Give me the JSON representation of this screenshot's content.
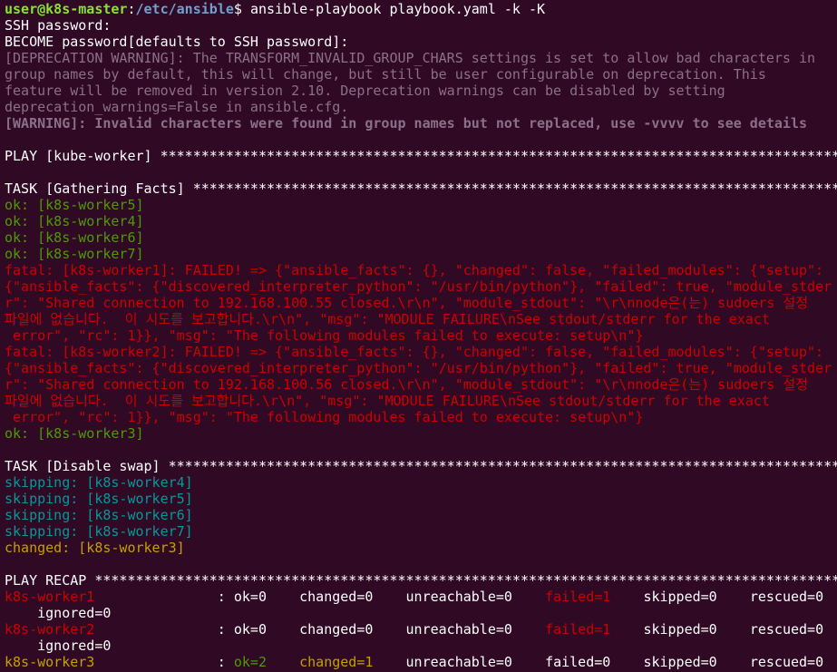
{
  "colors": {
    "background": "#300a24",
    "prompt_user": "#8ae234",
    "prompt_path": "#729fcf",
    "text": "#ffffff",
    "dim": "#8c6f8a",
    "ok": "#4e9a06",
    "fatal": "#cc0000",
    "skipping": "#06989a",
    "changed": "#c4a000"
  },
  "prompt": {
    "user_host": "user@k8s-master",
    "colon": ":",
    "path": "/etc/ansible",
    "dollar": "$ ",
    "command": "ansible-playbook playbook.yaml -k -K"
  },
  "lines": {
    "ssh_password": "SSH password:",
    "become_password": "BECOME password[defaults to SSH password]:",
    "deprecation_1": "[DEPRECATION WARNING]: The TRANSFORM_INVALID_GROUP_CHARS settings is set to allow bad characters in",
    "deprecation_2": "group names by default, this will change, but still be user configurable on deprecation. This",
    "deprecation_3": "feature will be removed in version 2.10. Deprecation warnings can be disabled by setting",
    "deprecation_4": "deprecation_warnings=False in ansible.cfg.",
    "warning": "[WARNING]: Invalid characters were found in group names but not replaced, use -vvvv to see details",
    "play_header": "PLAY [kube-worker] ************************************************************************************",
    "task_facts": "TASK [Gathering Facts] ********************************************************************************",
    "ok_worker5": "ok: [k8s-worker5]",
    "ok_worker4": "ok: [k8s-worker4]",
    "ok_worker6": "ok: [k8s-worker6]",
    "ok_worker7": "ok: [k8s-worker7]",
    "fatal1_1": "fatal: [k8s-worker1]: FAILED! => {\"ansible_facts\": {}, \"changed\": false, \"failed_modules\": {\"setup\":",
    "fatal1_2": "{\"ansible_facts\": {\"discovered_interpreter_python\": \"/usr/bin/python\"}, \"failed\": true, \"module_stder",
    "fatal1_3": "r\": \"Shared connection to 192.168.100.55 closed.\\r\\n\", \"module_stdout\": \"\\r\\nnode은(는) sudoers 설정",
    "fatal1_4": "파일에 없습니다.  이 시도를 보고합니다.\\r\\n\", \"msg\": \"MODULE FAILURE\\nSee stdout/stderr for the exact",
    "fatal1_5": " error\", \"rc\": 1}}, \"msg\": \"The following modules failed to execute: setup\\n\"}",
    "fatal2_1": "fatal: [k8s-worker2]: FAILED! => {\"ansible_facts\": {}, \"changed\": false, \"failed_modules\": {\"setup\":",
    "fatal2_2": "{\"ansible_facts\": {\"discovered_interpreter_python\": \"/usr/bin/python\"}, \"failed\": true, \"module_stder",
    "fatal2_3": "r\": \"Shared connection to 192.168.100.56 closed.\\r\\n\", \"module_stdout\": \"\\r\\nnode은(는) sudoers 설정",
    "fatal2_4": "파일에 없습니다.  이 시도를 보고합니다.\\r\\n\", \"msg\": \"MODULE FAILURE\\nSee stdout/stderr for the exact",
    "fatal2_5": " error\", \"rc\": 1}}, \"msg\": \"The following modules failed to execute: setup\\n\"}",
    "ok_worker3": "ok: [k8s-worker3]",
    "task_swap": "TASK [Disable swap] ***********************************************************************************",
    "skip_worker4": "skipping: [k8s-worker4]",
    "skip_worker5": "skipping: [k8s-worker5]",
    "skip_worker6": "skipping: [k8s-worker6]",
    "skip_worker7": "skipping: [k8s-worker7]",
    "changed_worker3": "changed: [k8s-worker3]",
    "play_recap": "PLAY RECAP ********************************************************************************************"
  },
  "recap": {
    "worker1": {
      "host": "k8s-worker1",
      "sep": "               : ",
      "ok": "ok=0",
      "changed": "changed=0",
      "unreachable": "unreachable=0",
      "failed": "failed=1",
      "skipped": "skipped=0",
      "rescued": "rescued=0",
      "ignored": "ignored=0"
    },
    "worker2": {
      "host": "k8s-worker2",
      "sep": "               : ",
      "ok": "ok=0",
      "changed": "changed=0",
      "unreachable": "unreachable=0",
      "failed": "failed=1",
      "skipped": "skipped=0",
      "rescued": "rescued=0",
      "ignored": "ignored=0"
    },
    "worker3": {
      "host": "k8s-worker3",
      "sep": "               : ",
      "ok": "ok=2",
      "changed": "changed=1",
      "unreachable": "unreachable=0",
      "failed": "failed=0",
      "skipped": "skipped=0",
      "rescued": "rescued=0"
    }
  }
}
